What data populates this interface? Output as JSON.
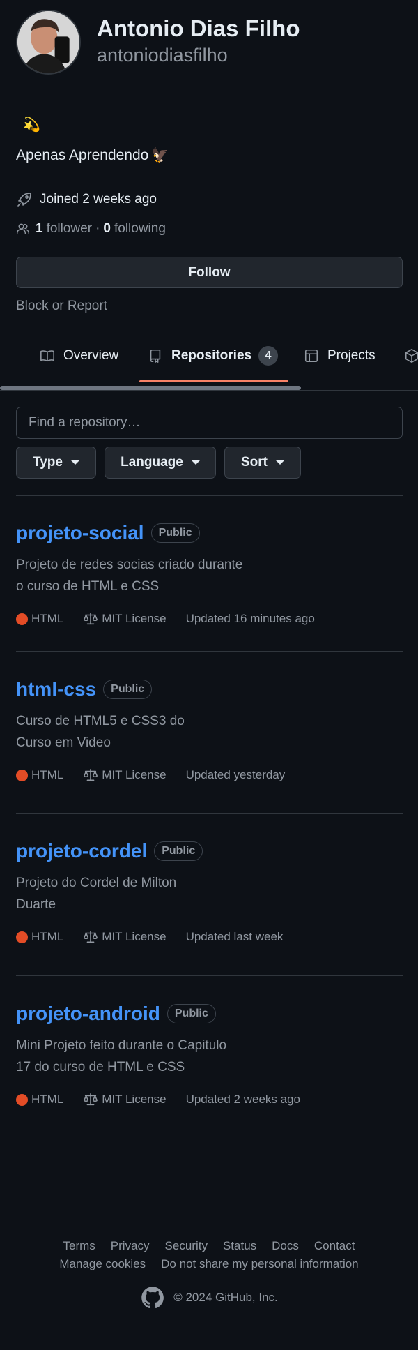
{
  "profile": {
    "name": "Antonio Dias Filho",
    "login": "antoniodiasfilho",
    "status_emoji": "💫",
    "bio": "Apenas Aprendendo",
    "bio_emoji": "🦅",
    "joined": "Joined 2 weeks ago",
    "followers_count": "1",
    "followers_label": "follower",
    "separator": "·",
    "following_count": "0",
    "following_label": "following",
    "follow_button": "Follow",
    "block_link": "Block or Report"
  },
  "tabs": [
    {
      "label": "Overview",
      "icon": "book-icon"
    },
    {
      "label": "Repositories",
      "icon": "repo-icon",
      "count": "4",
      "active": true
    },
    {
      "label": "Projects",
      "icon": "table-icon"
    },
    {
      "label": "",
      "icon": "package-icon"
    }
  ],
  "filters": {
    "search_placeholder": "Find a repository…",
    "type": "Type",
    "language": "Language",
    "sort": "Sort"
  },
  "repos": [
    {
      "name": "projeto-social",
      "visibility": "Public",
      "description": "Projeto de redes socias criado durante o curso de HTML e CSS",
      "language": "HTML",
      "license": "MIT License",
      "updated": "Updated 16 minutes ago"
    },
    {
      "name": "html-css",
      "visibility": "Public",
      "description": "Curso de HTML5 e CSS3 do Curso em Video",
      "language": "HTML",
      "license": "MIT License",
      "updated": "Updated yesterday"
    },
    {
      "name": "projeto-cordel",
      "visibility": "Public",
      "description": "Projeto do Cordel de Milton Duarte",
      "language": "HTML",
      "license": "MIT License",
      "updated": "Updated last week"
    },
    {
      "name": "projeto-android",
      "visibility": "Public",
      "description": "Mini Projeto feito durante o Capitulo 17 do curso de HTML e CSS",
      "language": "HTML",
      "license": "MIT License",
      "updated": "Updated 2 weeks ago"
    }
  ],
  "colors": {
    "background": "#0d1117",
    "link": "#4493f8",
    "html_language": "#e34c26",
    "tab_underline": "#f78166"
  },
  "footer": {
    "links": [
      "Terms",
      "Privacy",
      "Security",
      "Status",
      "Docs",
      "Contact"
    ],
    "links2": [
      "Manage cookies",
      "Do not share my personal information"
    ],
    "copyright": "© 2024 GitHub, Inc."
  }
}
